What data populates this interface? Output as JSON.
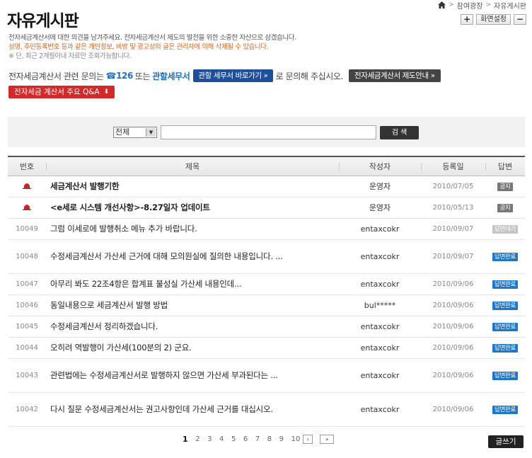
{
  "breadcrumb": {
    "items": [
      "참여광장",
      "자유게시판"
    ],
    "separator": ">"
  },
  "page_title": "자유게시판",
  "top_buttons": {
    "plus": "+",
    "settings": "화면설정",
    "minus": "−"
  },
  "notice": {
    "line1": "전자세금계산서에 대한 의견을 남겨주세요. 전자세금계산서 제도의 발전을 위한 소중한 자산으로 삼겠습니다.",
    "line2": "성명, 주민등록번호 등과 같은 개인정보, 비방 및 광고성의 글은 관리자에 의해 삭제될 수 있습니다.",
    "line3": "※ 단, 최근 2개월이내 자료만 조회가능합니다."
  },
  "inquiry": {
    "prefix": "전자세금계산서 관련 문의는",
    "phone": "☎126",
    "middle": "또는",
    "office": "관할세무서",
    "office_button": "관할 세무서 바로가기 »",
    "suffix": "로 문의해 주십시오.",
    "guide_button": "전자세금계산서 제도안내 »"
  },
  "qa_button": "전자세금 계산서 주요 Q&A",
  "search": {
    "select_value": "전체",
    "button": "검 색"
  },
  "table": {
    "headers": [
      "번호",
      "제목",
      "작성자",
      "등록일",
      "답변"
    ],
    "rows": [
      {
        "num": "",
        "title": "세금계산서 발행기한",
        "author": "운영자",
        "date": "2010/07/05",
        "status": "공지",
        "type": "gongji"
      },
      {
        "num": "",
        "title": "<e세로 시스템 개선사항>-8.27일자 업데이트",
        "author": "운영자",
        "date": "2010/05/13",
        "status": "공지",
        "type": "gongji"
      },
      {
        "num": "10049",
        "title": "그럼 이세로에 발행취소 메뉴 추가 바랍니다.",
        "author": "entaxcokr",
        "date": "2010/09/07",
        "status": "답변대기",
        "type": "wait"
      },
      {
        "num": "10048",
        "title": "수정세금계산서 가산세 근거에 대해 모의원실에 질의한 내용입니다. ...",
        "author": "entaxcokr",
        "date": "2010/09/07",
        "status": "답변완료",
        "type": "done"
      },
      {
        "num": "10047",
        "title": "아무리 봐도 22조4항은 합계표 불성실 가산세 내용인데...",
        "author": "entaxcokr",
        "date": "2010/09/06",
        "status": "답변완료",
        "type": "done"
      },
      {
        "num": "10046",
        "title": "동일내용으로 세금계산서 발행 방법",
        "author": "bul*****",
        "date": "2010/09/06",
        "status": "답변완료",
        "type": "done"
      },
      {
        "num": "10045",
        "title": "수정세금계산서 정리하겠습니다.",
        "author": "entaxcokr",
        "date": "2010/09/06",
        "status": "답변완료",
        "type": "done"
      },
      {
        "num": "10044",
        "title": "오히려 역발행이 가산세(100분의 2) 군요.",
        "author": "entaxcokr",
        "date": "2010/09/06",
        "status": "답변완료",
        "type": "done"
      },
      {
        "num": "10043",
        "title": "관련법에는 수정세금계산서로 발행하지 않으면 가산세 부과된다는 ...",
        "author": "entaxcokr",
        "date": "2010/09/06",
        "status": "답변완료",
        "type": "done"
      },
      {
        "num": "10042",
        "title": "다시 질문 수정세금계산서는 권고사항인데 가산세 근거를 대십시오.",
        "author": "entaxcokr",
        "date": "2010/09/06",
        "status": "답변완료",
        "type": "done"
      }
    ]
  },
  "pagination": {
    "pages": [
      "1",
      "2",
      "3",
      "4",
      "5",
      "6",
      "7",
      "8",
      "9",
      "10"
    ],
    "current": "1",
    "next": "›",
    "last": "»"
  },
  "write_button": "글쓰기",
  "colors": {
    "blue_button": "#1d4f9a",
    "red_button": "#d22a2a",
    "done_badge": "#1f77c9",
    "notice_orange": "#e0621a"
  }
}
